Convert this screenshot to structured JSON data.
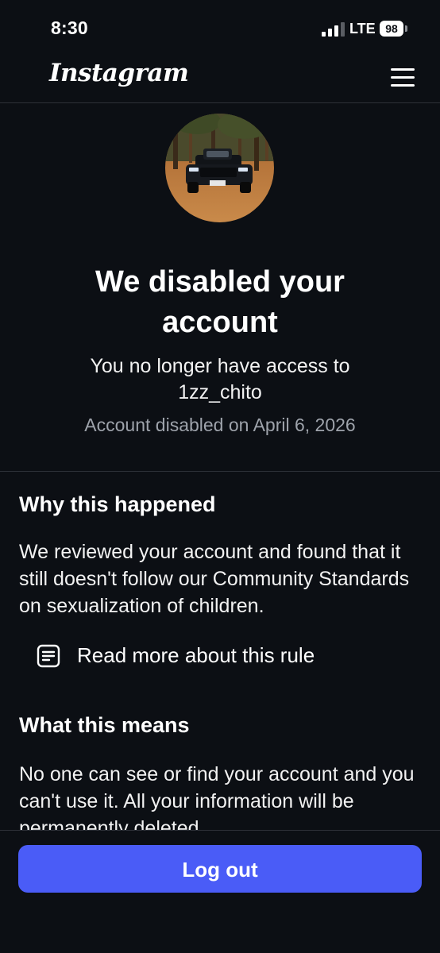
{
  "status_bar": {
    "time": "8:30",
    "network": "LTE",
    "battery": "98"
  },
  "header": {
    "logo_text": "Instagram",
    "menu_icon": "hamburger-menu-icon"
  },
  "profile": {
    "avatar_description_icon": "profile-photo"
  },
  "notice": {
    "title": "We disabled your account",
    "subtitle_line1": "You no longer have access to",
    "username": "1zz_chito",
    "disabled_date": "Account disabled on April 6, 2026"
  },
  "why_section": {
    "heading": "Why this happened",
    "body": "We reviewed your account and found that it still doesn't follow our Community Standards on sexualization of children.",
    "rule_link_label": "Read more about this rule",
    "rule_link_icon": "document-icon"
  },
  "means_section": {
    "heading": "What this means",
    "body": "No one can see or find your account and you can't use it. All your information will be permanently deleted."
  },
  "footer": {
    "logout_label": "Log out"
  },
  "colors": {
    "background": "#0c0f14",
    "accent": "#4a5cf7",
    "muted_text": "#9ea3ab",
    "divider": "#2d3138"
  }
}
